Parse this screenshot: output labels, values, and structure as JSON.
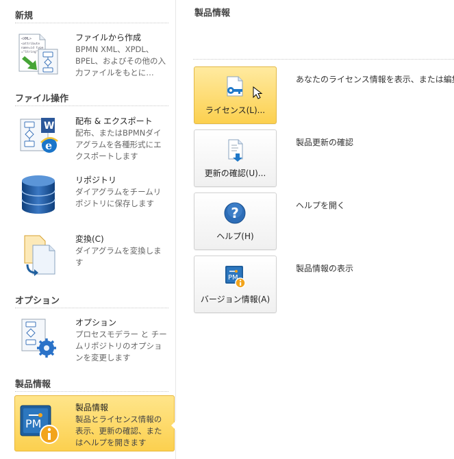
{
  "left": {
    "sections": [
      {
        "title": "新規"
      },
      {
        "title": "ファイル操作"
      },
      {
        "title": "オプション"
      },
      {
        "title": "製品情報"
      }
    ],
    "items": [
      {
        "title": "ファイルから作成",
        "desc": "BPMN XML、XPDL、BPEL、およびその他の入力ファイルをもとに…",
        "icon": "xml-file-icon"
      },
      {
        "title": "配布 & エクスポート",
        "desc": "配布、またはBPMNダイアグラムを各種形式にエクスポートします",
        "icon": "export-icon"
      },
      {
        "title": "リポジトリ",
        "desc": "ダイアグラムをチームリポジトリに保存します",
        "icon": "database-icon"
      },
      {
        "title": "変換(C)",
        "desc": "ダイアグラムを変換します",
        "icon": "convert-icon"
      },
      {
        "title": "オプション",
        "desc": "プロセスモデラー と チームリポジトリのオプションを変更します",
        "icon": "options-icon"
      },
      {
        "title": "製品情報",
        "desc": "製品とライセンス情報の表示、更新の確認、またはヘルプを開きます",
        "icon": "pm-info-icon",
        "selected": true
      }
    ]
  },
  "right": {
    "title": "製品情報",
    "actions": [
      {
        "label": "ライセンス(L)...",
        "desc": "あなたのライセンス情報を表示、または編集",
        "icon": "license-key-icon",
        "hovered": true
      },
      {
        "label": "更新の確認(U)...",
        "desc": "製品更新の確認",
        "icon": "update-check-icon"
      },
      {
        "label": "ヘルプ(H)",
        "desc": "ヘルプを開く",
        "icon": "help-icon"
      },
      {
        "label": "バージョン情報(A)",
        "desc": "製品情報の表示",
        "icon": "version-info-icon"
      }
    ]
  },
  "colors": {
    "selected_bg": "#fcd04f",
    "selected_border": "#e8b73a",
    "help_blue": "#2d6db7",
    "pm_blue": "#1f5f9e",
    "info_orange": "#f2a41c"
  }
}
